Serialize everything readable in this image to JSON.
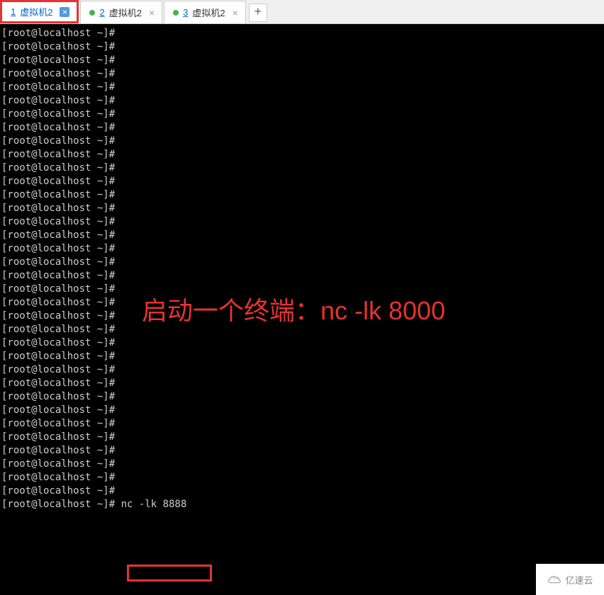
{
  "tabs": [
    {
      "num": "1",
      "label": "虚拟机2",
      "active": true
    },
    {
      "num": "2",
      "label": "虚拟机2",
      "active": false
    },
    {
      "num": "3",
      "label": "虚拟机2",
      "active": false
    }
  ],
  "add_tab": "+",
  "terminal": {
    "prompt": "[root@localhost ~]#",
    "empty_line_count": 35,
    "command": "nc -lk 8888"
  },
  "annotation": "启动一个终端：nc -lk 8000",
  "watermark": "亿速云",
  "colors": {
    "highlight": "#e63232",
    "link": "#0066cc",
    "status_dot": "#4caf50"
  }
}
